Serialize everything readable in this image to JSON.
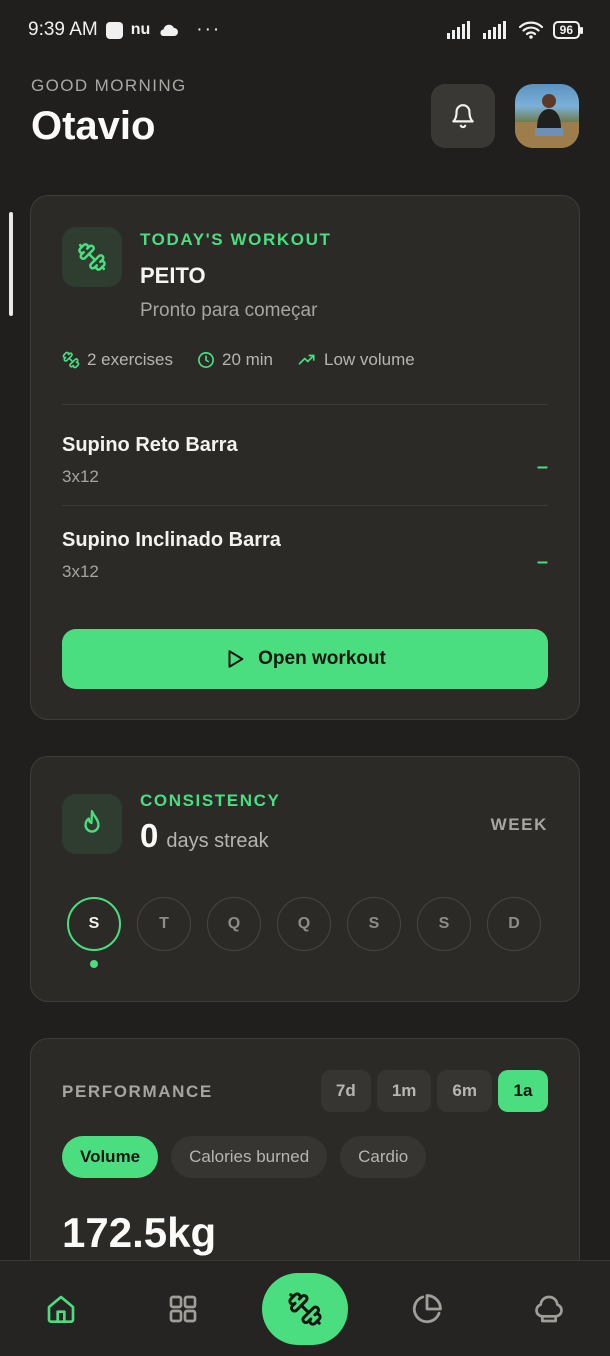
{
  "status_bar": {
    "time": "9:39 AM",
    "app_label": "nu",
    "battery": "96"
  },
  "header": {
    "greeting": "GOOD MORNING",
    "user_name": "Otavio"
  },
  "workout_card": {
    "section_label": "TODAY'S WORKOUT",
    "workout_name": "PEITO",
    "subtitle": "Pronto para começar",
    "meta": {
      "exercises": "2 exercises",
      "duration": "20 min",
      "volume": "Low volume"
    },
    "exercises": [
      {
        "name": "Supino Reto Barra",
        "sets": "3x12",
        "status": "–"
      },
      {
        "name": "Supino Inclinado Barra",
        "sets": "3x12",
        "status": "–"
      }
    ],
    "open_button": "Open workout"
  },
  "consistency_card": {
    "section_label": "CONSISTENCY",
    "streak_value": "0",
    "streak_text": "days streak",
    "period_label": "WEEK",
    "days": [
      "S",
      "T",
      "Q",
      "Q",
      "S",
      "S",
      "D"
    ],
    "active_day_index": 0
  },
  "performance_card": {
    "section_label": "PERFORMANCE",
    "ranges": [
      "7d",
      "1m",
      "6m",
      "1a"
    ],
    "active_range": "1a",
    "metrics": [
      "Volume",
      "Calories burned",
      "Cardio"
    ],
    "active_metric": "Volume",
    "value": "172.5kg"
  },
  "bottom_nav": {
    "items": [
      "home-icon",
      "grid-icon",
      "dumbbell-icon",
      "pie-chart-icon",
      "chef-hat-icon"
    ],
    "active": "home-icon"
  },
  "colors": {
    "accent": "#4ade80",
    "background": "#201f1d",
    "card": "#2b2a27"
  }
}
